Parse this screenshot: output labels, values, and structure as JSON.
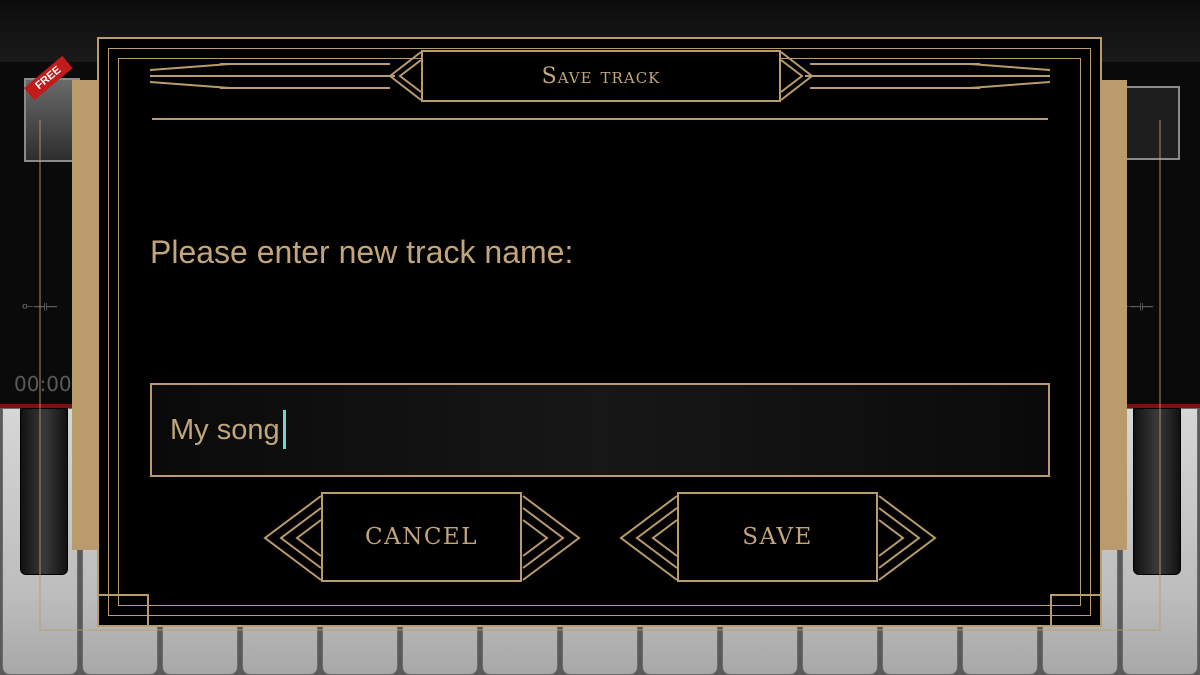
{
  "background_app": {
    "free_badge": "FREE",
    "time_display": "00:00"
  },
  "dialog": {
    "title": "Save track",
    "prompt": "Please enter new track name:",
    "track_name_value": "My song",
    "cancel_label": "CANCEL",
    "save_label": "SAVE"
  },
  "colors": {
    "gold": "#b99b6c",
    "text_gold": "#c2a57a",
    "caret": "#6fd8d0",
    "background": "#000000"
  }
}
